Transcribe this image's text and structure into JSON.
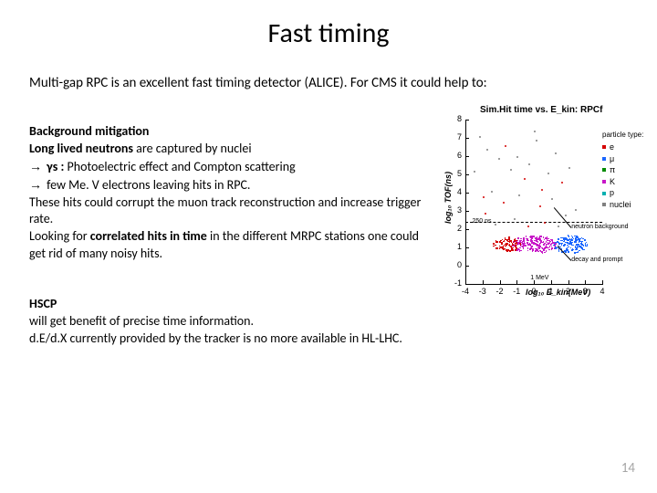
{
  "title": "Fast timing",
  "intro": "Multi-gap RPC is an excellent fast timing detector (ALICE). For CMS it could help to:",
  "bg": {
    "heading": "Background mitigation",
    "l1a": "Long lived neutrons",
    "l1b": " are captured by nuclei",
    "l2a": "γs :",
    "l2b": " Photoelectric effect and Compton scattering",
    "l3": "  few Me. V  electrons  leaving hits in RPC.",
    "l4": "These hits could corrupt the muon track reconstruction and increase trigger rate.",
    "l5a": "Looking for ",
    "l5b": "correlated hits in  time",
    "l5c": " in the different MRPC stations one could get rid  of many noisy hits."
  },
  "hscp": {
    "heading": "HSCP",
    "l1": "will get benefit of precise time information.",
    "l2": "d.E/d.X currently provided by the tracker is no more available in HL-LHC."
  },
  "page": "14",
  "chart_data": {
    "type": "scatter",
    "title": "Sim.Hit time vs. E_kin: RPCf",
    "xlabel": "log₁₀ E_kin(MeV)",
    "ylabel": "log₁₀ TOF(ns)",
    "xlim": [
      -4,
      4
    ],
    "ylim": [
      -1,
      8
    ],
    "yticks": [
      -1,
      0,
      1,
      2,
      3,
      4,
      5,
      6,
      7,
      8
    ],
    "xticks": [
      -4,
      -3,
      -2,
      -1,
      0,
      1,
      2,
      3,
      4
    ],
    "legend_title": "particle type:",
    "series": [
      {
        "name": "e",
        "color": "#d40000"
      },
      {
        "name": "μ",
        "color": "#1a66ff"
      },
      {
        "name": "π",
        "color": "#008a00"
      },
      {
        "name": "K",
        "color": "#c717c7"
      },
      {
        "name": "p",
        "color": "#00b0b0"
      },
      {
        "name": "nuclei",
        "color": "#808080"
      }
    ],
    "dense_clusters": [
      {
        "cx": 0.0,
        "cy": 1.2,
        "rx": 1.3,
        "ry": 0.5,
        "n": 220,
        "color": "#c717c7"
      },
      {
        "cx": 2.1,
        "cy": 1.2,
        "rx": 1.0,
        "ry": 0.5,
        "n": 160,
        "color": "#1a66ff"
      },
      {
        "cx": -1.6,
        "cy": 1.2,
        "rx": 0.8,
        "ry": 0.4,
        "n": 90,
        "color": "#d40000"
      }
    ],
    "sparse_points": [
      {
        "x": -3.2,
        "y": 7.1,
        "c": "#808080"
      },
      {
        "x": -2.8,
        "y": 6.4,
        "c": "#808080"
      },
      {
        "x": -2.1,
        "y": 5.9,
        "c": "#808080"
      },
      {
        "x": -1.7,
        "y": 6.6,
        "c": "#d40000"
      },
      {
        "x": -1.4,
        "y": 5.3,
        "c": "#808080"
      },
      {
        "x": -1.0,
        "y": 6.0,
        "c": "#808080"
      },
      {
        "x": -0.6,
        "y": 4.8,
        "c": "#d40000"
      },
      {
        "x": -0.3,
        "y": 5.6,
        "c": "#808080"
      },
      {
        "x": 0.1,
        "y": 6.9,
        "c": "#808080"
      },
      {
        "x": 0.4,
        "y": 4.2,
        "c": "#d40000"
      },
      {
        "x": 0.8,
        "y": 5.1,
        "c": "#808080"
      },
      {
        "x": 1.2,
        "y": 6.2,
        "c": "#808080"
      },
      {
        "x": 1.6,
        "y": 4.6,
        "c": "#d40000"
      },
      {
        "x": -2.5,
        "y": 4.1,
        "c": "#808080"
      },
      {
        "x": -1.8,
        "y": 3.5,
        "c": "#d40000"
      },
      {
        "x": -0.9,
        "y": 3.9,
        "c": "#808080"
      },
      {
        "x": 0.3,
        "y": 3.3,
        "c": "#d40000"
      },
      {
        "x": 1.0,
        "y": 3.7,
        "c": "#808080"
      },
      {
        "x": -2.9,
        "y": 2.9,
        "c": "#d40000"
      },
      {
        "x": -1.2,
        "y": 2.6,
        "c": "#808080"
      },
      {
        "x": 0.6,
        "y": 2.4,
        "c": "#d40000"
      },
      {
        "x": 1.8,
        "y": 2.8,
        "c": "#808080"
      },
      {
        "x": -3.5,
        "y": 5.2,
        "c": "#808080"
      },
      {
        "x": -3.0,
        "y": 3.8,
        "c": "#d40000"
      },
      {
        "x": 2.4,
        "y": 3.1,
        "c": "#808080"
      },
      {
        "x": 2.0,
        "y": 5.4,
        "c": "#808080"
      },
      {
        "x": 0.0,
        "y": 7.4,
        "c": "#808080"
      },
      {
        "x": -0.4,
        "y": 2.2,
        "c": "#d40000"
      },
      {
        "x": 1.4,
        "y": 2.2,
        "c": "#808080"
      },
      {
        "x": -2.3,
        "y": 2.3,
        "c": "#808080"
      }
    ],
    "annotations": [
      {
        "text": "neutron background",
        "x": 2.2,
        "y": 2.1,
        "ax": 1.2,
        "ay": 3.2
      },
      {
        "text": "decay and prompt",
        "x": 2.2,
        "y": 0.3,
        "ax": 1.4,
        "ay": 1.1
      },
      {
        "text": "250 ns",
        "x": -3.6,
        "y": 2.4
      },
      {
        "text": "1 MeV",
        "x": -0.2,
        "y": -0.7
      }
    ],
    "hline_y": 2.4,
    "vline_x": 0
  }
}
